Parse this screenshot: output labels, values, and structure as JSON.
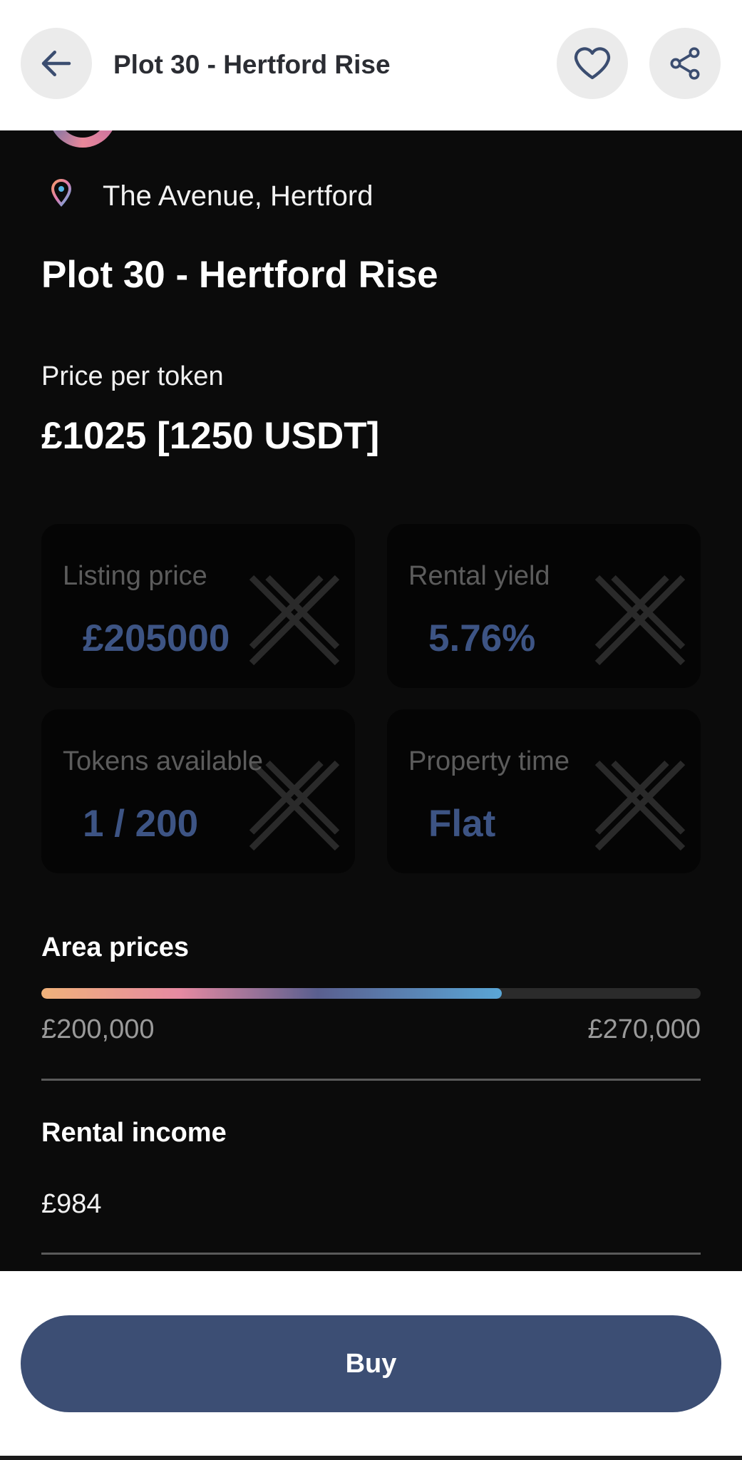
{
  "header": {
    "title": "Plot 30 - Hertford Rise",
    "back_icon": "arrow-left-icon",
    "favorite_icon": "heart-outline-icon",
    "share_icon": "share-icon"
  },
  "property": {
    "location": "The Avenue, Hertford",
    "title": "Plot 30 - Hertford Rise",
    "price_per_token_label": "Price per token",
    "price_per_token_value": "£1025 [1250 USDT]"
  },
  "stats": [
    {
      "label": "Listing price",
      "value": "£205000"
    },
    {
      "label": "Rental yield",
      "value": "5.76%"
    },
    {
      "label": "Tokens available",
      "value": "1 / 200"
    },
    {
      "label": "Property time",
      "value": "Flat"
    }
  ],
  "area_prices": {
    "title": "Area prices",
    "min": "£200,000",
    "max": "£270,000",
    "fill_fraction": 0.698
  },
  "rental_income": {
    "title": "Rental income",
    "value": "£984"
  },
  "buy_button": "Buy",
  "colors": {
    "accent": "#3c4e74",
    "card_value": "#3d5484",
    "background_dark": "#0b0b0b"
  }
}
